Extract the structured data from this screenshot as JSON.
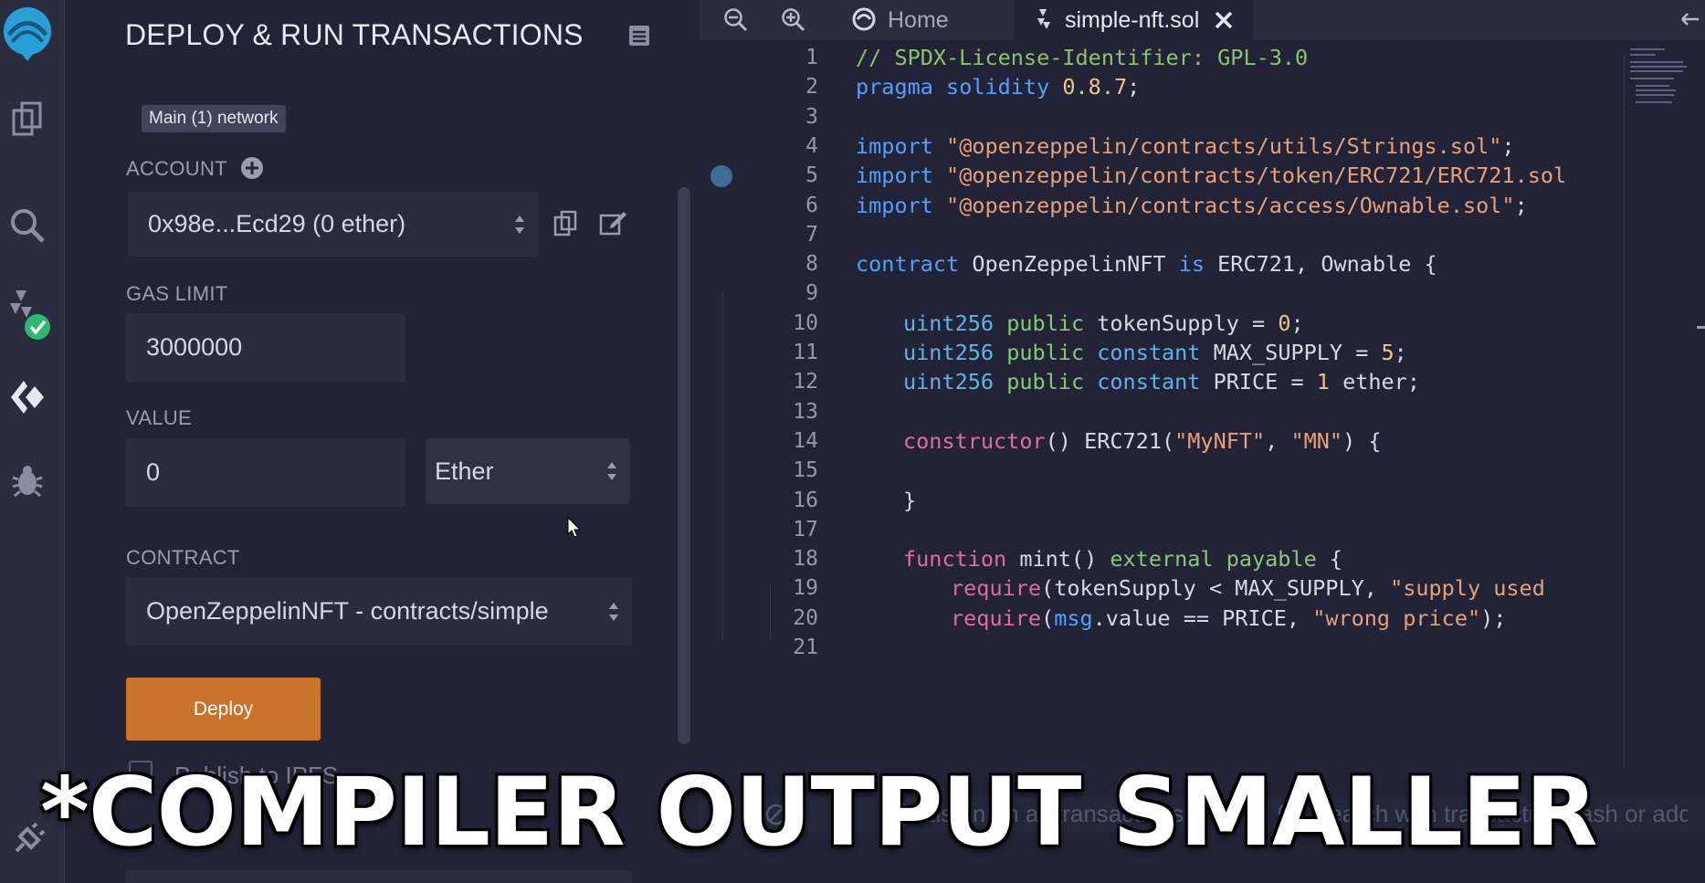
{
  "panel": {
    "title": "DEPLOY & RUN TRANSACTIONS",
    "network_badge": "Main (1) network",
    "account_label": "ACCOUNT",
    "account_value": "0x98e...Ecd29 (0 ether)",
    "gas_limit_label": "GAS LIMIT",
    "gas_limit_value": "3000000",
    "value_label": "VALUE",
    "value_value": "0",
    "value_unit": "Ether",
    "contract_label": "CONTRACT",
    "contract_value": "OpenZeppelinNFT - contracts/simple",
    "deploy_label": "Deploy",
    "publish_label": "Publish to IPFS"
  },
  "tabs": [
    {
      "label": "Home",
      "icon": "remix-logo-icon"
    },
    {
      "label": "simple-nft.sol",
      "icon": "solidity-icon"
    }
  ],
  "code_lines": [
    {
      "n": "1",
      "t": "// SPDX-License-Identifier: GPL-3.0"
    },
    {
      "n": "2",
      "t": "pragma solidity 0.8.7;"
    },
    {
      "n": "3",
      "t": ""
    },
    {
      "n": "4",
      "t": "import \"@openzeppelin/contracts/utils/Strings.sol\";"
    },
    {
      "n": "5",
      "t": "import \"@openzeppelin/contracts/token/ERC721/ERC721.sol"
    },
    {
      "n": "6",
      "t": "import \"@openzeppelin/contracts/access/Ownable.sol\";"
    },
    {
      "n": "7",
      "t": ""
    },
    {
      "n": "8",
      "t": "contract OpenZeppelinNFT is ERC721, Ownable {"
    },
    {
      "n": "9",
      "t": ""
    },
    {
      "n": "10",
      "t": "uint256 public tokenSupply = 0;"
    },
    {
      "n": "11",
      "t": "uint256 public constant MAX_SUPPLY = 5;"
    },
    {
      "n": "12",
      "t": "uint256 public constant PRICE = 1 ether;"
    },
    {
      "n": "13",
      "t": ""
    },
    {
      "n": "14",
      "t": "constructor() ERC721(\"MyNFT\", \"MN\") {"
    },
    {
      "n": "15",
      "t": ""
    },
    {
      "n": "16",
      "t": "}"
    },
    {
      "n": "17",
      "t": ""
    },
    {
      "n": "18",
      "t": "function mint() external payable {"
    },
    {
      "n": "19",
      "t": "require(tokenSupply < MAX_SUPPLY, \"supply used"
    },
    {
      "n": "20",
      "t": "require(msg.value == PRICE, \"wrong price\");"
    },
    {
      "n": "21",
      "t": ""
    }
  ],
  "terminal": {
    "listen_label": "Listen on all transactions",
    "search_placeholder": "Search with transaction hash or address"
  },
  "caption": "*COMPILER OUTPUT SMALLER",
  "colors": {
    "accent": "#c9722a",
    "background": "#222336",
    "panel": "#2a2c3f",
    "check_green": "#2fb86c",
    "keyword_blue": "#4fa0ff"
  }
}
